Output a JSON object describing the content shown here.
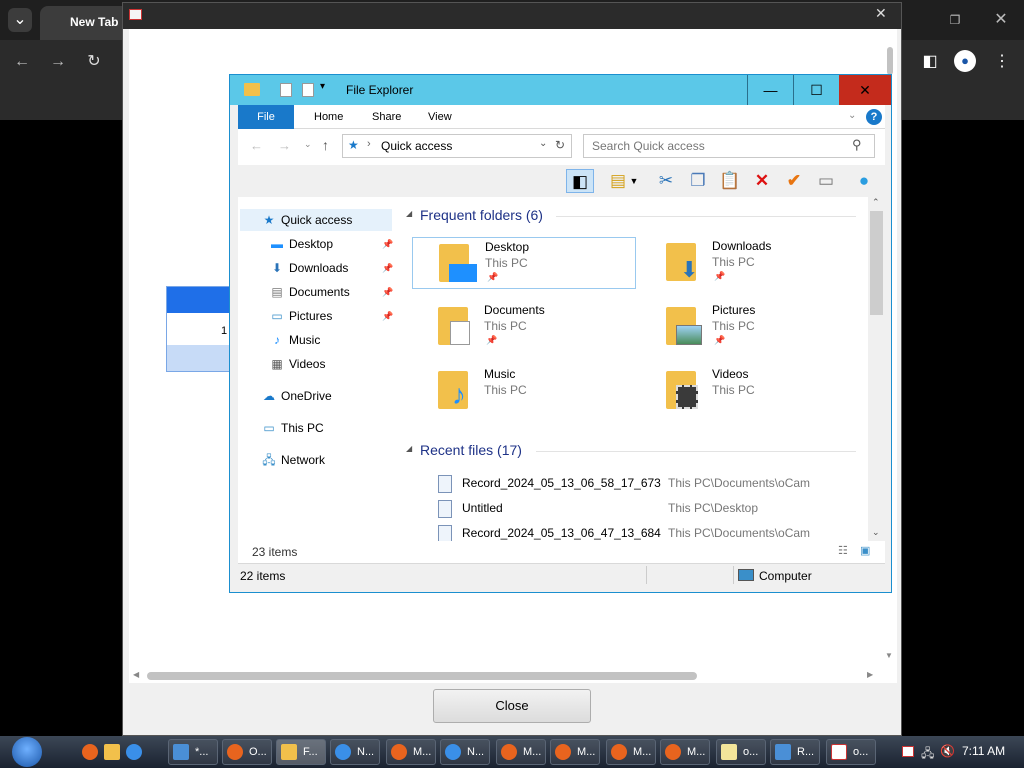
{
  "chrome": {
    "tab_title": "New Tab"
  },
  "dialog": {
    "close_label": "Close"
  },
  "explorer": {
    "title": "File Explorer",
    "ribbon_tabs": [
      "File",
      "Home",
      "Share",
      "View"
    ],
    "address": "Quick access",
    "search_placeholder": "Search Quick access",
    "nav": {
      "quick_access": "Quick access",
      "desktop": "Desktop",
      "downloads": "Downloads",
      "documents": "Documents",
      "pictures": "Pictures",
      "music": "Music",
      "videos": "Videos",
      "onedrive": "OneDrive",
      "this_pc": "This PC",
      "network": "Network"
    },
    "frequent_header": "Frequent folders (6)",
    "folders": [
      {
        "name": "Desktop",
        "sub": "This PC",
        "pinned": true
      },
      {
        "name": "Downloads",
        "sub": "This PC",
        "pinned": true
      },
      {
        "name": "Documents",
        "sub": "This PC",
        "pinned": true
      },
      {
        "name": "Pictures",
        "sub": "This PC",
        "pinned": true
      },
      {
        "name": "Music",
        "sub": "This PC",
        "pinned": false
      },
      {
        "name": "Videos",
        "sub": "This PC",
        "pinned": false
      }
    ],
    "recent_header": "Recent files (17)",
    "recent": [
      {
        "name": "Record_2024_05_13_06_58_17_673",
        "path": "This PC\\Documents\\oCam"
      },
      {
        "name": "Untitled",
        "path": "This PC\\Desktop"
      },
      {
        "name": "Record_2024_05_13_06_47_13_684",
        "path": "This PC\\Documents\\oCam"
      }
    ],
    "item_count_inner": "23 items",
    "item_count_status": "22 items",
    "status_location": "Computer"
  },
  "taskbar": {
    "items": [
      "*...",
      "O...",
      "F...",
      "N...",
      "M...",
      "N...",
      "M...",
      "M...",
      "M...",
      "M...",
      "o...",
      "R...",
      "o..."
    ],
    "clock": "7:11 AM"
  },
  "stub_table": {
    "value": "1"
  }
}
